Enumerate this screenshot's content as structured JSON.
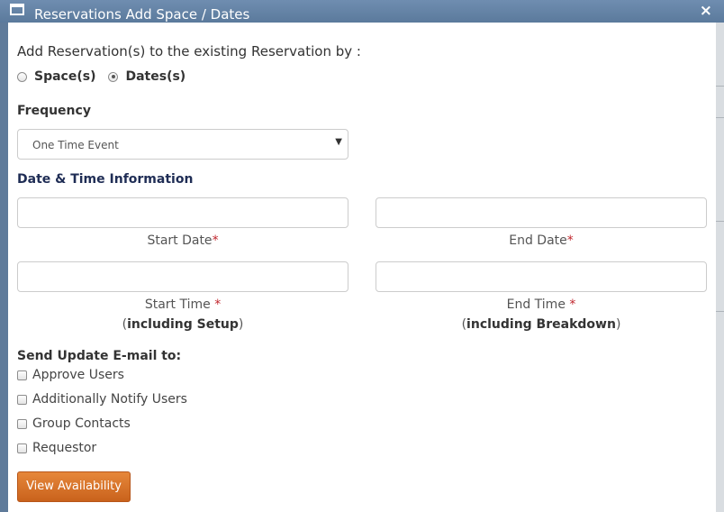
{
  "dialog": {
    "title": "Reservations Add Space / Dates",
    "close_label": "×"
  },
  "form": {
    "intro": "Add Reservation(s) to the existing Reservation by :",
    "mode_options": [
      {
        "label": "Space(s)",
        "checked": false
      },
      {
        "label": "Dates(s)",
        "checked": true
      }
    ],
    "frequency_label": "Frequency",
    "frequency_value": "One Time Event",
    "section_title": "Date & Time Information",
    "start_date_label": "Start Date",
    "end_date_label": "End Date",
    "start_time_label": "Start Time ",
    "end_time_label": "End Time ",
    "start_time_note": "including Setup",
    "end_time_note": "including Breakdown",
    "required_mark": "*",
    "notify_heading": "Send Update E-mail to:",
    "notify_options": [
      "Approve Users",
      "Additionally Notify Users",
      "Group Contacts",
      "Requestor"
    ],
    "button_label": "View Availability"
  },
  "colors": {
    "accent_button": "#d9732b",
    "section_title": "#1f2d55",
    "required": "#c0262d",
    "titlebar": "#5f7b9a"
  },
  "icons": [
    "window-icon",
    "close-icon",
    "dropdown-arrow-icon"
  ]
}
